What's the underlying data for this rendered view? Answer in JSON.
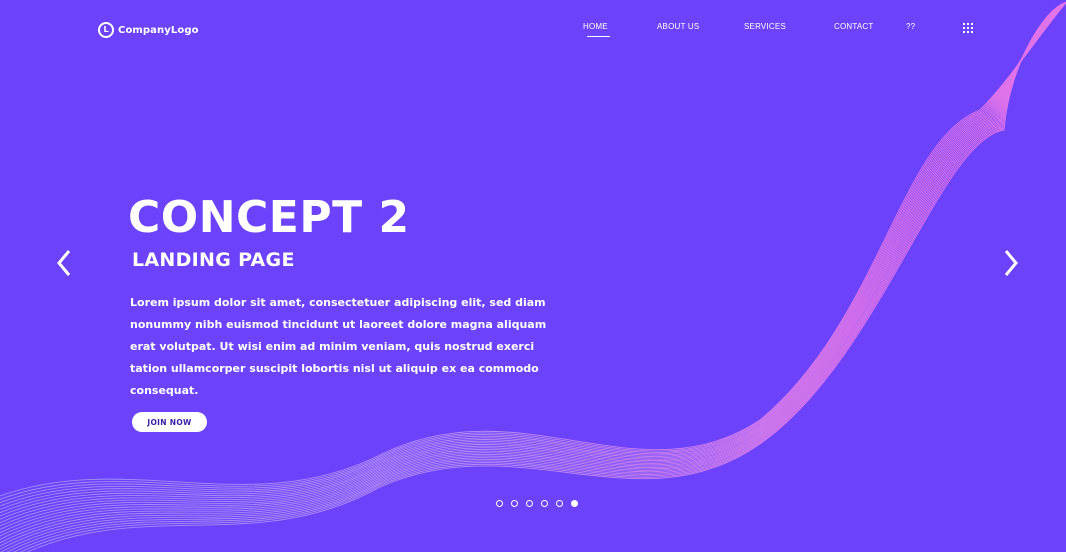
{
  "brand": {
    "logo_mark": "L",
    "logo_text": "CompanyLogo"
  },
  "nav": {
    "items": [
      {
        "label": "HOME",
        "active": true
      },
      {
        "label": "ABOUT US",
        "active": false
      },
      {
        "label": "SERVICES",
        "active": false
      },
      {
        "label": "CONTACT",
        "active": false
      },
      {
        "label": "??",
        "active": false
      }
    ],
    "menu_icon": "grid-menu-icon"
  },
  "hero": {
    "title": "CONCEPT 2",
    "subtitle": "LANDING PAGE",
    "body": "Lorem ipsum dolor sit amet, consectetuer adipiscing elit, sed diam nonummy nibh euismod tincidunt ut laoreet dolore magna aliquam erat volutpat. Ut wisi enim ad minim veniam, quis nostrud exerci tation ullamcorper suscipit lobortis nisl ut aliquip ex ea commodo consequat.",
    "cta_label": "JOIN NOW"
  },
  "carousel": {
    "prev_icon": "chevron-left-icon",
    "next_icon": "chevron-right-icon",
    "slide_count": 6,
    "active_index": 5
  },
  "colors": {
    "background": "#6c42fb",
    "wave_pink": "#f77ce6",
    "wave_light": "#c5b4ff",
    "text": "#ffffff",
    "button_text": "#3b1ea8"
  }
}
